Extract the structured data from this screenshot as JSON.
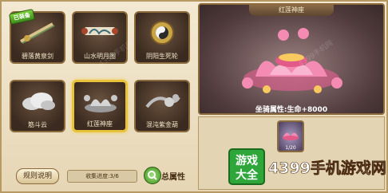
{
  "badge": "已装备",
  "slots": [
    {
      "name": "碧落黄泉剑",
      "selected": false
    },
    {
      "name": "山水明月图",
      "selected": false
    },
    {
      "name": "阴阳生死轮",
      "selected": false
    },
    {
      "name": "筋斗云",
      "selected": false
    },
    {
      "name": "红莲神座",
      "selected": true
    },
    {
      "name": "混沌紫金葫",
      "selected": false
    }
  ],
  "bottom": {
    "rules_label": "规则说明",
    "progress_label": "收集进度:3/6",
    "total_label": "总属性"
  },
  "display": {
    "title": "红莲神座",
    "stat_text": "坐骑属性:生命+8000"
  },
  "variant": {
    "count": "1/20"
  },
  "watermark": {
    "logo_line1": "游戏",
    "logo_line2": "大全",
    "site_text": "4399手机游戏网",
    "faint": "4399手机网"
  }
}
